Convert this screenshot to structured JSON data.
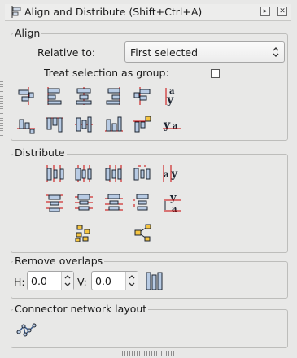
{
  "window": {
    "title": "Align and Distribute (Shift+Ctrl+A)"
  },
  "align": {
    "section_label": "Align",
    "relative_to_label": "Relative to:",
    "relative_to_value": "First selected",
    "treat_group_label": "Treat selection as group:",
    "treat_group_checked": false
  },
  "distribute": {
    "section_label": "Distribute"
  },
  "remove_overlaps": {
    "section_label": "Remove overlaps",
    "h_label": "H:",
    "h_value": "0.0",
    "v_label": "V:",
    "v_value": "0.0"
  },
  "connector": {
    "section_label": "Connector network layout"
  },
  "colors": {
    "box_fill": "#b8cbe4",
    "box_stroke": "#1c2430",
    "guide_red": "#c80000",
    "node_yellow": "#f5c542"
  }
}
